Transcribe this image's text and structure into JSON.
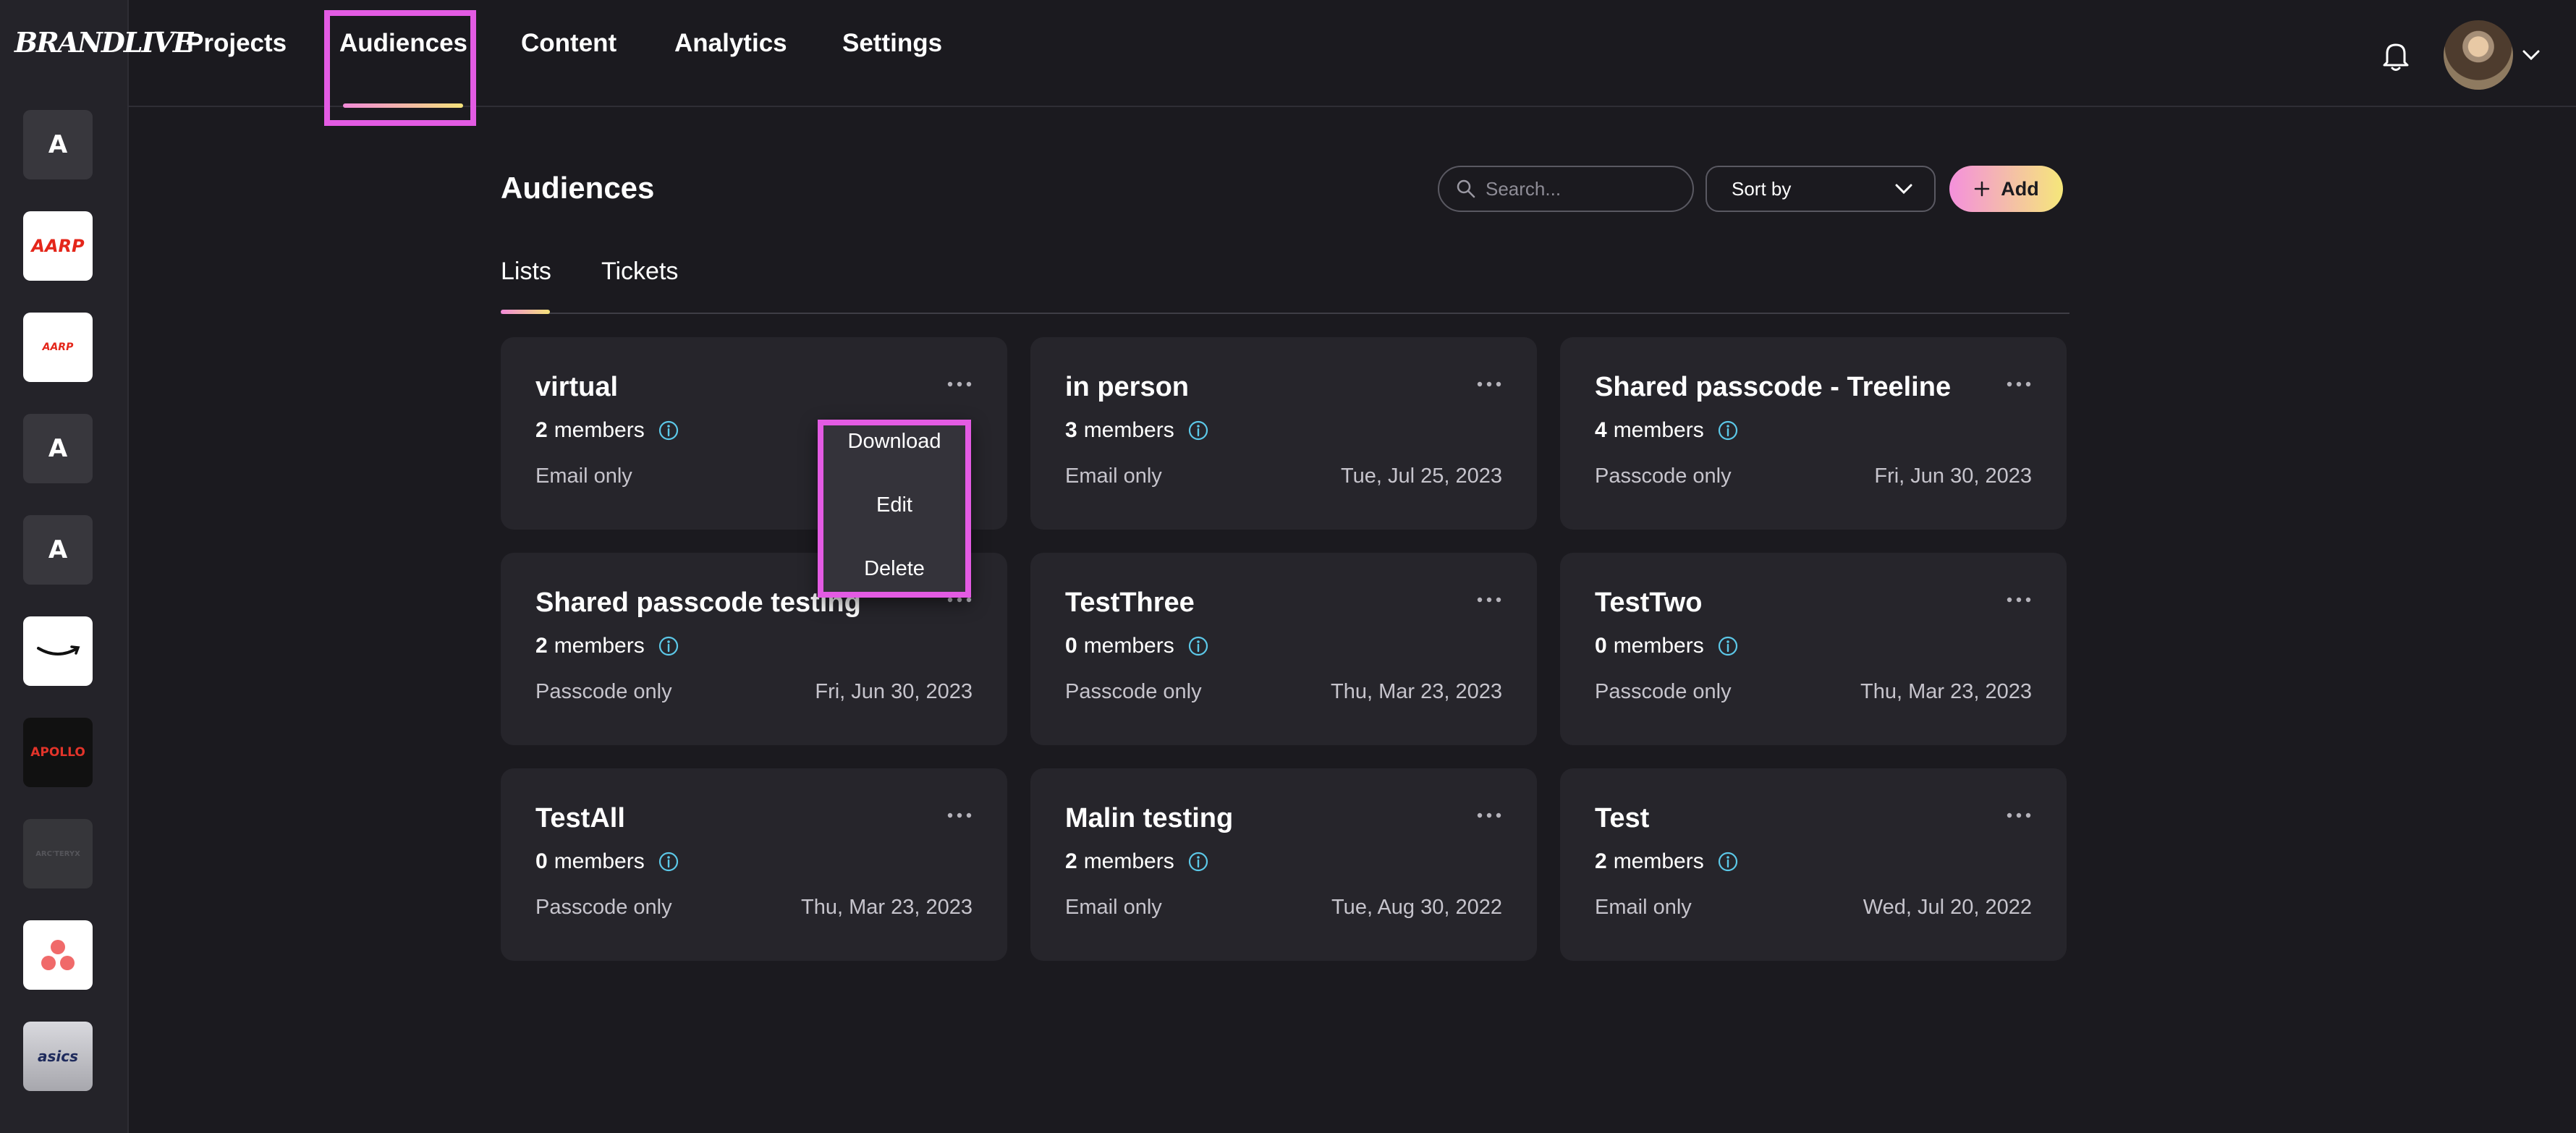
{
  "app": {
    "logo_text": "BRANDLIVE"
  },
  "sidebar": {
    "brands": [
      {
        "label": "A",
        "icon": "letter-a-avatar"
      },
      {
        "label": "AARP",
        "icon": "aarp-logo"
      },
      {
        "label": "AARP",
        "icon": "aarp-logo"
      },
      {
        "label": "A",
        "icon": "letter-a-avatar"
      },
      {
        "label": "A",
        "icon": "letter-a-avatar"
      },
      {
        "label": "",
        "icon": "amazon-logo"
      },
      {
        "label": "APOLLO",
        "icon": "apollo-logo"
      },
      {
        "label": "ARC'TERYX",
        "icon": "arcteryx-logo"
      },
      {
        "label": "",
        "icon": "asana-logo"
      },
      {
        "label": "asics",
        "icon": "asics-logo"
      }
    ]
  },
  "nav": {
    "items": [
      "Projects",
      "Audiences",
      "Content",
      "Analytics",
      "Settings"
    ],
    "active": "Audiences"
  },
  "header": {
    "title": "Audiences",
    "search_placeholder": "Search...",
    "sort_label": "Sort by",
    "add_label": "Add"
  },
  "tabs": {
    "items": [
      "Lists",
      "Tickets"
    ],
    "active": "Lists"
  },
  "members_word": "members",
  "cards": [
    {
      "title": "virtual",
      "members": "2",
      "access": "Email only",
      "date": ""
    },
    {
      "title": "in person",
      "members": "3",
      "access": "Email only",
      "date": "Tue, Jul 25, 2023"
    },
    {
      "title": "Shared passcode - Treeline",
      "members": "4",
      "access": "Passcode only",
      "date": "Fri, Jun 30, 2023"
    },
    {
      "title": "Shared passcode testing",
      "members": "2",
      "access": "Passcode only",
      "date": "Fri, Jun 30, 2023"
    },
    {
      "title": "TestThree",
      "members": "0",
      "access": "Passcode only",
      "date": "Thu, Mar 23, 2023"
    },
    {
      "title": "TestTwo",
      "members": "0",
      "access": "Passcode only",
      "date": "Thu, Mar 23, 2023"
    },
    {
      "title": "TestAll",
      "members": "0",
      "access": "Passcode only",
      "date": "Thu, Mar 23, 2023"
    },
    {
      "title": "Malin testing",
      "members": "2",
      "access": "Email only",
      "date": "Tue, Aug 30, 2022"
    },
    {
      "title": "Test",
      "members": "2",
      "access": "Email only",
      "date": "Wed, Jul 20, 2022"
    }
  ],
  "context_menu": {
    "items": [
      "Download",
      "Edit",
      "Delete"
    ]
  },
  "colors": {
    "background": "#1b1a1f",
    "card": "#26252b",
    "accent_pink": "#f28ad8",
    "accent_yellow": "#f4e27a",
    "highlight": "#e35be3",
    "info_icon": "#5cc8e8"
  }
}
